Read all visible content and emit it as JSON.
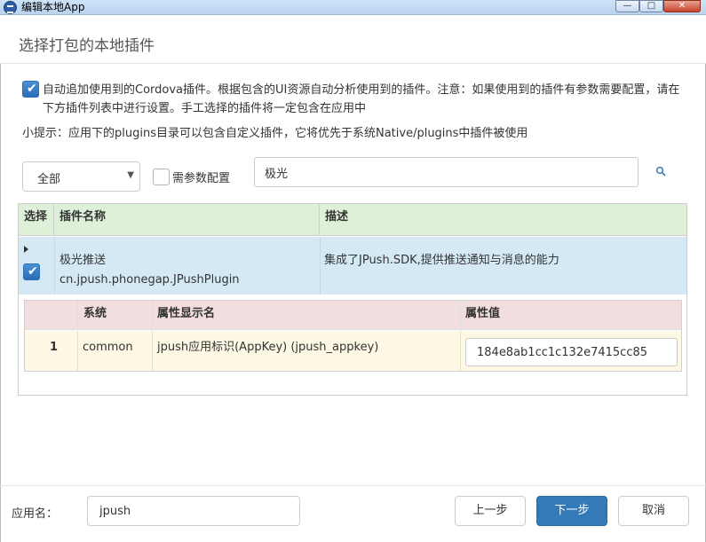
{
  "window": {
    "title": "编辑本地App",
    "minimize_glyph": "—",
    "maximize_glyph": "□",
    "close_glyph": "✕"
  },
  "dialog": {
    "title": "选择打包的本地插件"
  },
  "auto_add": {
    "checked": true,
    "text": "自动追加使用到的Cordova插件。根据包含的UI资源自动分析使用到的插件。注意：如果使用到的插件有参数需要配置，请在下方插件列表中进行设置。手工选择的插件将一定包含在应用中"
  },
  "tip": {
    "text": "小提示：应用下的plugins目录可以包含自定义插件，它将优先于系统Native/plugins中插件被使用"
  },
  "filter": {
    "category_value": "全部",
    "param_config_label": "需参数配置",
    "param_config_checked": false,
    "search_value": "极光",
    "search_icon": "search-icon"
  },
  "table": {
    "headers": {
      "select": "选择",
      "name": "插件名称",
      "desc": "描述"
    },
    "rows": [
      {
        "checked": true,
        "name": "极光推送",
        "id": "cn.jpush.phonegap.JPushPlugin",
        "desc": "集成了JPush.SDK,提供推送通知与消息的能力",
        "params": {
          "headers": {
            "system": "系统",
            "display": "属性显示名",
            "value": "属性值"
          },
          "rows": [
            {
              "index": "1",
              "system": "common",
              "display": "jpush应用标识(AppKey) (jpush_appkey)",
              "value": "184e8ab1cc1c132e7415cc85"
            }
          ]
        }
      }
    ]
  },
  "footer": {
    "app_name_label": "应用名：",
    "app_name_value": "jpush",
    "prev_label": "上一步",
    "next_label": "下一步",
    "cancel_label": "取消"
  },
  "colors": {
    "primary": "#337ab7",
    "header_green": "#dff0d8",
    "row_blue": "#d5e9f4",
    "sub_header_pink": "#f2dede",
    "sub_row_yellow": "#fcf8e3"
  }
}
